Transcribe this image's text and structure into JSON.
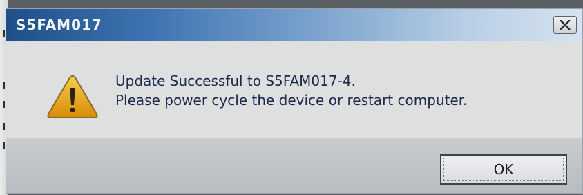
{
  "dialog": {
    "title": "S5FAM017",
    "close_icon": "close-x-icon",
    "warning_icon": "warning-triangle-icon",
    "message_lines": [
      "Update Successful to S5FAM017-4.",
      "Please power cycle the device or restart computer."
    ],
    "ok_label": "OK"
  },
  "colors": {
    "title_bar_start": "#1f4f87",
    "title_bar_end": "#d6e2ef",
    "message_text": "#1d2a4d",
    "warning_fill": "#e6a20e"
  }
}
